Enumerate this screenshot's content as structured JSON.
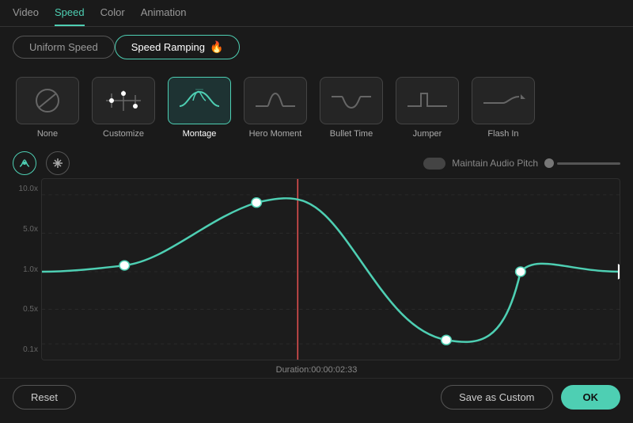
{
  "topNav": {
    "items": [
      {
        "label": "Video",
        "active": false
      },
      {
        "label": "Speed",
        "active": true
      },
      {
        "label": "Color",
        "active": false
      },
      {
        "label": "Animation",
        "active": false
      }
    ]
  },
  "modeSelector": {
    "uniform": "Uniform Speed",
    "ramping": "Speed Ramping"
  },
  "presets": [
    {
      "id": "none",
      "label": "None",
      "selected": false
    },
    {
      "id": "customize",
      "label": "Customize",
      "selected": false
    },
    {
      "id": "montage",
      "label": "Montage",
      "selected": true
    },
    {
      "id": "hero-moment",
      "label": "Hero Moment",
      "selected": false
    },
    {
      "id": "bullet-time",
      "label": "Bullet Time",
      "selected": false
    },
    {
      "id": "jumper",
      "label": "Jumper",
      "selected": false
    },
    {
      "id": "flash-in",
      "label": "Flash In",
      "selected": false
    }
  ],
  "controls": {
    "audioLabel": "Maintain Audio Pitch"
  },
  "graph": {
    "yLabels": [
      "10.0x",
      "5.0x",
      "1.0x",
      "0.5x",
      "0.1x"
    ],
    "duration": "Duration:00:00:02:33"
  },
  "bottomBar": {
    "reset": "Reset",
    "saveAsCustom": "Save as Custom",
    "ok": "OK"
  }
}
